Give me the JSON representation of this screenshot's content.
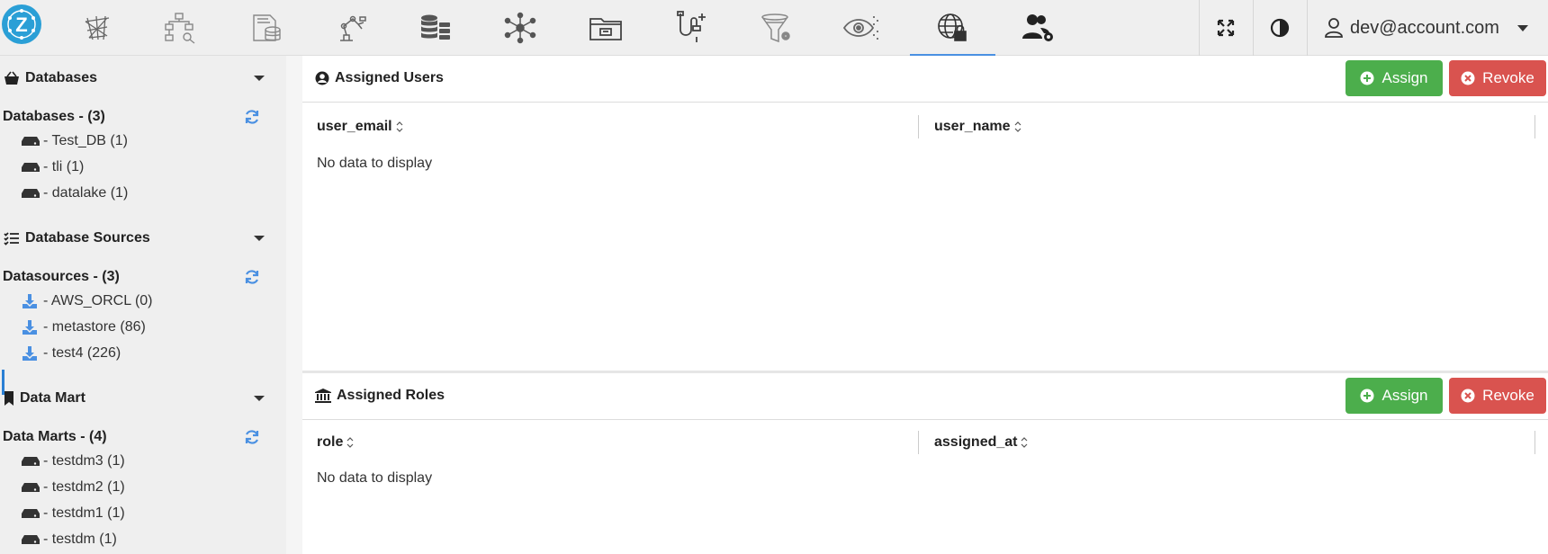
{
  "user": {
    "email": "dev@account.com"
  },
  "sidebar": {
    "databases": {
      "section_label": "Databases",
      "group_label": "Databases - (3)",
      "items": [
        "- Test_DB (1)",
        "- tli (1)",
        "- datalake (1)"
      ]
    },
    "sources": {
      "section_label": "Database Sources",
      "group_label": "Datasources - (3)",
      "items": [
        "- AWS_ORCL (0)",
        "- metastore (86)",
        "- test4 (226)"
      ]
    },
    "datamart": {
      "section_label": "Data Mart",
      "group_label": "Data Marts - (4)",
      "items": [
        "- testdm3 (1)",
        "- testdm2 (1)",
        "- testdm1 (1)",
        "- testdm (1)"
      ]
    }
  },
  "users_panel": {
    "title": "Assigned Users",
    "assign_label": "Assign",
    "revoke_label": "Revoke",
    "columns": [
      "user_email",
      "user_name"
    ],
    "empty_text": "No data to display"
  },
  "roles_panel": {
    "title": "Assigned Roles",
    "assign_label": "Assign",
    "revoke_label": "Revoke",
    "columns": [
      "role",
      "assigned_at"
    ],
    "empty_text": "No data to display"
  },
  "colors": {
    "accent": "#4a90e2",
    "assign": "#4cae4c",
    "revoke": "#d9534f",
    "logo": "#2a9fd6"
  }
}
